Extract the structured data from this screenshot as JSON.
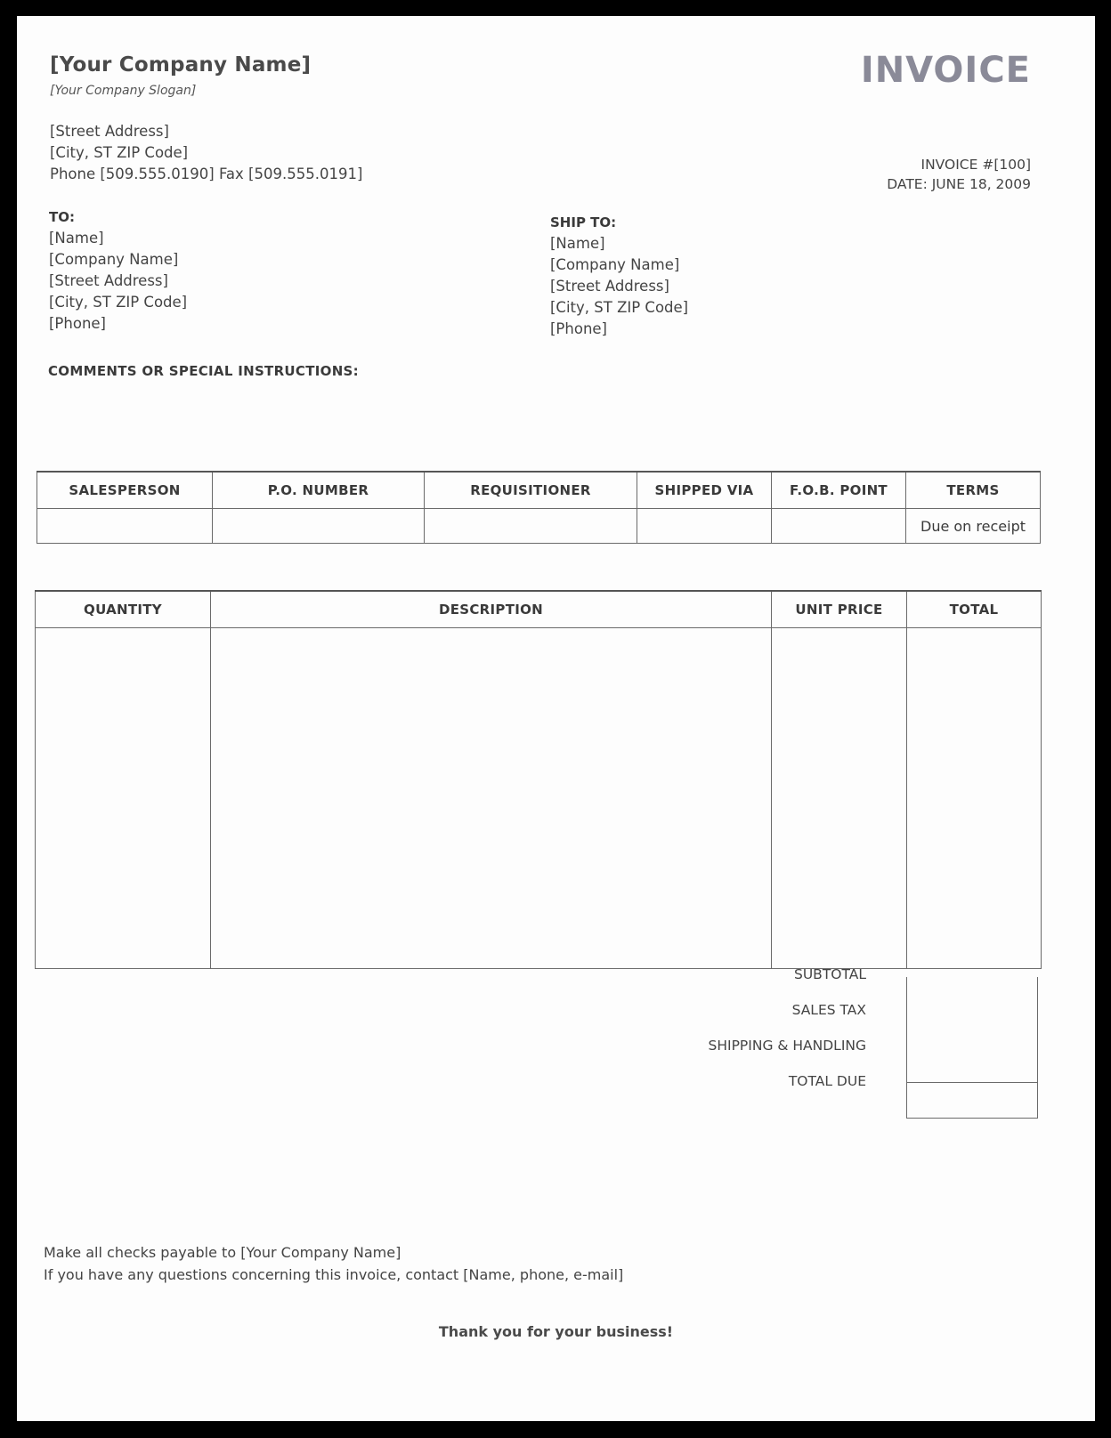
{
  "header": {
    "company_name": "[Your Company Name]",
    "slogan": "[Your Company Slogan]",
    "address_lines": [
      "[Street Address]",
      "[City, ST  ZIP Code]",
      "Phone [509.555.0190]  Fax [509.555.0191]"
    ],
    "doc_title": "INVOICE",
    "invoice_number": "INVOICE #[100]",
    "date": "DATE: JUNE 18, 2009"
  },
  "bill_to": {
    "label": "TO:",
    "lines": [
      "[Name]",
      "[Company Name]",
      "[Street Address]",
      "[City, ST  ZIP Code]",
      "[Phone]"
    ]
  },
  "ship_to": {
    "label": "SHIP TO:",
    "lines": [
      "[Name]",
      "[Company Name]",
      "[Street Address]",
      "[City, ST  ZIP Code]",
      "[Phone]"
    ]
  },
  "comments_label": "COMMENTS OR SPECIAL INSTRUCTIONS:",
  "order_table": {
    "headers": [
      "SALESPERSON",
      "P.O. NUMBER",
      "REQUISITIONER",
      "SHIPPED VIA",
      "F.O.B. POINT",
      "TERMS"
    ],
    "values": [
      "",
      "",
      "",
      "",
      "",
      "Due on receipt"
    ]
  },
  "items_table": {
    "headers": [
      "QUANTITY",
      "DESCRIPTION",
      "UNIT PRICE",
      "TOTAL"
    ],
    "rows": []
  },
  "totals": {
    "labels": [
      "SUBTOTAL",
      "SALES TAX",
      "SHIPPING & HANDLING",
      "TOTAL DUE"
    ],
    "values": [
      "",
      "",
      "",
      ""
    ]
  },
  "footer": {
    "lines": [
      "Make all checks payable to [Your Company Name]",
      "If you have any questions concerning this invoice, contact [Name, phone, e-mail]"
    ],
    "thanks": "Thank you for your business!"
  }
}
